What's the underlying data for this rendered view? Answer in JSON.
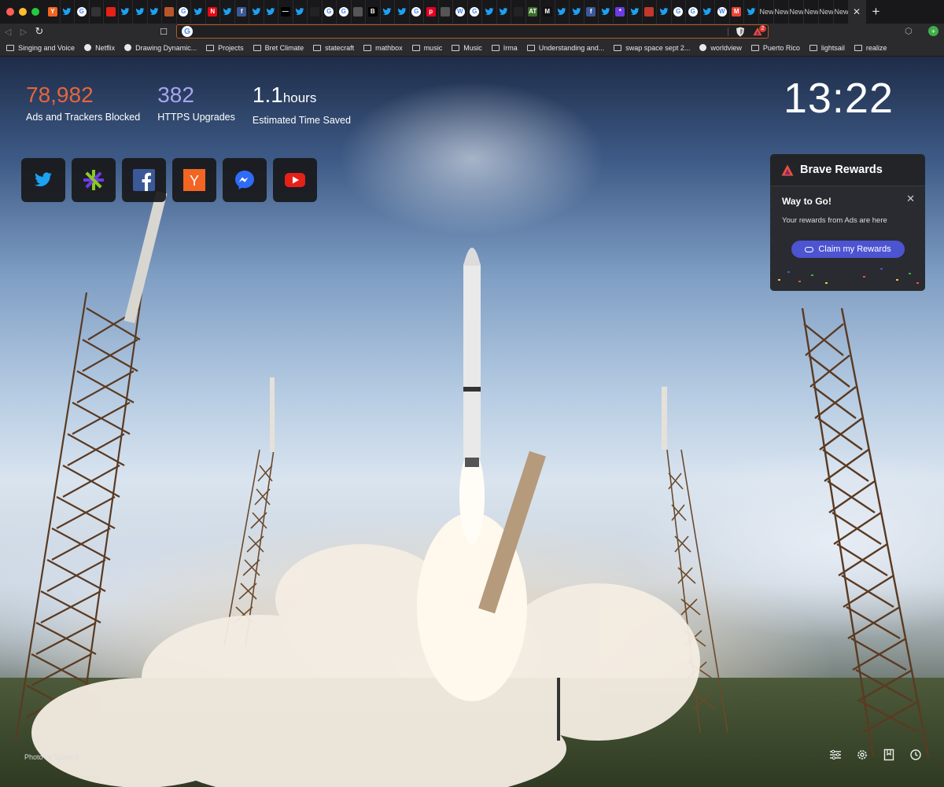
{
  "window": {
    "traffic_lights": [
      "#ff5f57",
      "#febc2e",
      "#28c840"
    ]
  },
  "tabs": {
    "favicons": [
      {
        "icon": "ycombinator-icon",
        "color": "#f26522",
        "glyph": "Y"
      },
      {
        "icon": "twitter-icon",
        "color": "#1da1f2",
        "glyph": ""
      },
      {
        "icon": "google-icon",
        "color": "#ffffff",
        "glyph": "G"
      },
      {
        "icon": "circle-icon",
        "color": "#333333",
        "glyph": ""
      },
      {
        "icon": "youtube-icon",
        "color": "#e62117",
        "glyph": ""
      },
      {
        "icon": "twitter-icon",
        "color": "#1da1f2",
        "glyph": ""
      },
      {
        "icon": "twitter-icon",
        "color": "#1da1f2",
        "glyph": ""
      },
      {
        "icon": "twitter-icon",
        "color": "#1da1f2",
        "glyph": ""
      },
      {
        "icon": "github-icon",
        "color": "#b8562b",
        "glyph": ""
      },
      {
        "icon": "google-icon",
        "color": "#ffffff",
        "glyph": "G"
      },
      {
        "icon": "twitter-icon",
        "color": "#1da1f2",
        "glyph": ""
      },
      {
        "icon": "netflix-icon",
        "color": "#e50914",
        "glyph": "N"
      },
      {
        "icon": "twitter-icon",
        "color": "#1da1f2",
        "glyph": ""
      },
      {
        "icon": "facebook-icon",
        "color": "#3b5998",
        "glyph": "f"
      },
      {
        "icon": "twitter-icon",
        "color": "#1da1f2",
        "glyph": ""
      },
      {
        "icon": "twitter-icon",
        "color": "#1da1f2",
        "glyph": ""
      },
      {
        "icon": "medium-icon",
        "color": "#000000",
        "glyph": "—"
      },
      {
        "icon": "twitter-icon",
        "color": "#1da1f2",
        "glyph": ""
      },
      {
        "icon": "pen-icon",
        "color": "#222222",
        "glyph": ""
      },
      {
        "icon": "google-icon",
        "color": "#ffffff",
        "glyph": "G"
      },
      {
        "icon": "google-icon",
        "color": "#ffffff",
        "glyph": "G"
      },
      {
        "icon": "circle-icon",
        "color": "#555555",
        "glyph": ""
      },
      {
        "icon": "bold-icon",
        "color": "#000000",
        "glyph": "B"
      },
      {
        "icon": "twitter-icon",
        "color": "#1da1f2",
        "glyph": ""
      },
      {
        "icon": "twitter-icon",
        "color": "#1da1f2",
        "glyph": ""
      },
      {
        "icon": "google-icon",
        "color": "#ffffff",
        "glyph": "G"
      },
      {
        "icon": "pinterest-icon",
        "color": "#e60023",
        "glyph": "p"
      },
      {
        "icon": "circle-icon",
        "color": "#555555",
        "glyph": ""
      },
      {
        "icon": "wikipedia-icon",
        "color": "#ffffff",
        "glyph": "W"
      },
      {
        "icon": "google-icon",
        "color": "#ffffff",
        "glyph": "G"
      },
      {
        "icon": "twitter-icon",
        "color": "#1da1f2",
        "glyph": ""
      },
      {
        "icon": "twitter-icon",
        "color": "#1da1f2",
        "glyph": ""
      },
      {
        "icon": "arrow-icon",
        "color": "#222222",
        "glyph": ""
      },
      {
        "icon": "at-icon",
        "color": "#3b6b2a",
        "glyph": "AT"
      },
      {
        "icon": "m-icon",
        "color": "#111111",
        "glyph": "M"
      },
      {
        "icon": "twitter-icon",
        "color": "#1da1f2",
        "glyph": ""
      },
      {
        "icon": "twitter-icon",
        "color": "#1da1f2",
        "glyph": ""
      },
      {
        "icon": "facebook-icon",
        "color": "#3b5998",
        "glyph": "f"
      },
      {
        "icon": "twitter-icon",
        "color": "#1da1f2",
        "glyph": ""
      },
      {
        "icon": "etrade-icon",
        "color": "#6c3be4",
        "glyph": "*"
      },
      {
        "icon": "twitter-icon",
        "color": "#1da1f2",
        "glyph": ""
      },
      {
        "icon": "mic-icon",
        "color": "#c0392b",
        "glyph": ""
      },
      {
        "icon": "twitter-icon",
        "color": "#1da1f2",
        "glyph": ""
      },
      {
        "icon": "google-icon",
        "color": "#ffffff",
        "glyph": "G"
      },
      {
        "icon": "google-icon",
        "color": "#ffffff",
        "glyph": "G"
      },
      {
        "icon": "twitter-icon",
        "color": "#1da1f2",
        "glyph": ""
      },
      {
        "icon": "wikipedia-icon",
        "color": "#ffffff",
        "glyph": "W"
      },
      {
        "icon": "gmail-icon",
        "color": "#ea4335",
        "glyph": "M"
      },
      {
        "icon": "twitter-icon",
        "color": "#1da1f2",
        "glyph": ""
      }
    ],
    "new_tab_labels": [
      "New",
      "New",
      "New",
      "New",
      "New",
      "New"
    ],
    "active_close": "✕",
    "new_tab_button": "+"
  },
  "toolbar": {
    "back": "◁",
    "forward": "▷",
    "reload": "↻",
    "bookmark": "☐",
    "omnibox_favicon": "G",
    "rewards_badge": "2"
  },
  "bookmarks": [
    {
      "label": "Singing and Voice",
      "type": "folder"
    },
    {
      "label": "Netflix",
      "type": "globe"
    },
    {
      "label": "Drawing Dynamic...",
      "type": "globe"
    },
    {
      "label": "Projects",
      "type": "folder"
    },
    {
      "label": "Bret Climate",
      "type": "folder"
    },
    {
      "label": "statecraft",
      "type": "folder"
    },
    {
      "label": "mathbox",
      "type": "folder"
    },
    {
      "label": "music",
      "type": "folder"
    },
    {
      "label": "Music",
      "type": "folder"
    },
    {
      "label": "Irma",
      "type": "folder"
    },
    {
      "label": "Understanding and...",
      "type": "folder"
    },
    {
      "label": "swap space sept 2...",
      "type": "folder"
    },
    {
      "label": "worldview",
      "type": "globe"
    },
    {
      "label": "Puerto Rico",
      "type": "folder"
    },
    {
      "label": "lightsail",
      "type": "folder"
    },
    {
      "label": "realize",
      "type": "folder"
    }
  ],
  "stats": {
    "ads_blocked": "78,982",
    "ads_blocked_label": "Ads and Trackers Blocked",
    "https_upgrades": "382",
    "https_upgrades_label": "HTTPS Upgrades",
    "time_saved": "1.1",
    "time_saved_unit": "hours",
    "time_saved_label": "Estimated Time Saved"
  },
  "clock": "13:22",
  "top_sites": [
    {
      "name": "twitter-icon",
      "color": "#1da1f2"
    },
    {
      "name": "etrade-icon",
      "color": "#6c3be4"
    },
    {
      "name": "facebook-icon",
      "color": "#3b5998"
    },
    {
      "name": "ycombinator-icon",
      "color": "#f26522"
    },
    {
      "name": "messenger-icon",
      "color": "#2f6bf6"
    },
    {
      "name": "youtube-icon",
      "color": "#e62117"
    }
  ],
  "rewards": {
    "title": "Brave Rewards",
    "notification_title": "Way to Go!",
    "notification_close": "✕",
    "notification_text": "Your rewards from Ads are here",
    "claim_button": "Claim my Rewards",
    "accent": "#4c54d2"
  },
  "photo_credit": "Photo by SpaceX",
  "bottom_tools": [
    "customize-icon",
    "settings-icon",
    "bookmarks-icon",
    "history-icon"
  ]
}
